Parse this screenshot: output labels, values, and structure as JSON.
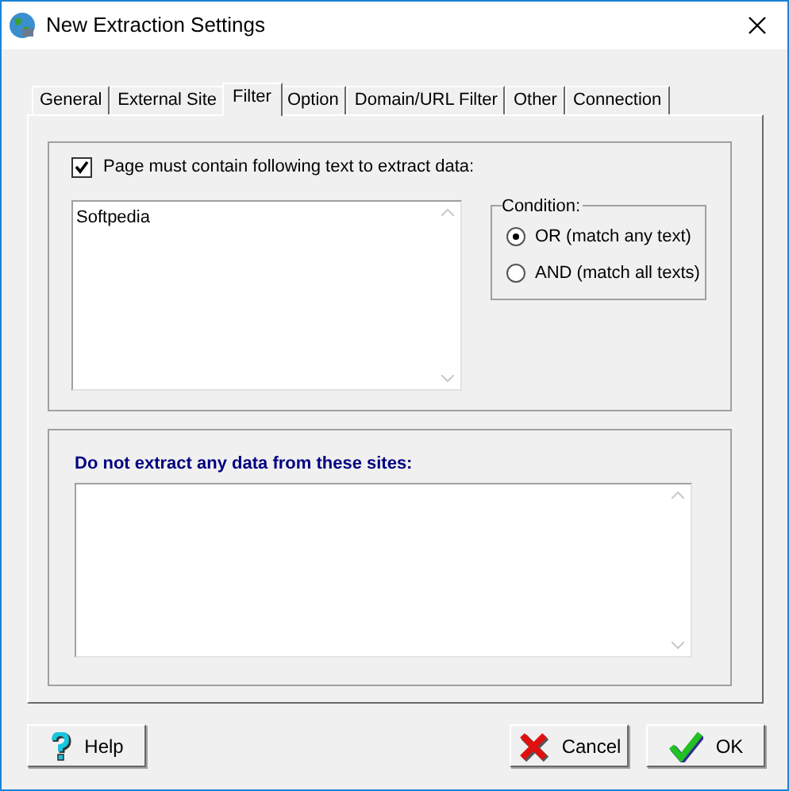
{
  "window": {
    "title": "New Extraction Settings"
  },
  "tabs": [
    {
      "label": "General",
      "selected": false
    },
    {
      "label": "External Site",
      "selected": false
    },
    {
      "label": "Filter",
      "selected": true
    },
    {
      "label": "Option",
      "selected": false
    },
    {
      "label": "Domain/URL Filter",
      "selected": false
    },
    {
      "label": "Other",
      "selected": false
    },
    {
      "label": "Connection",
      "selected": false
    }
  ],
  "include": {
    "label": "Page must contain following text to extract data:",
    "checked": true,
    "value": "Softpedia"
  },
  "condition": {
    "title": "Condition:",
    "options": [
      {
        "label": "OR (match any text)",
        "selected": true
      },
      {
        "label": "AND (match all texts)",
        "selected": false
      }
    ]
  },
  "exclude": {
    "label": "Do not extract any data from these sites:"
  },
  "buttons": [
    {
      "kind": "help",
      "label": "Help"
    },
    {
      "kind": "cancel",
      "label": "Cancel"
    },
    {
      "kind": "ok",
      "label": "OK"
    }
  ]
}
